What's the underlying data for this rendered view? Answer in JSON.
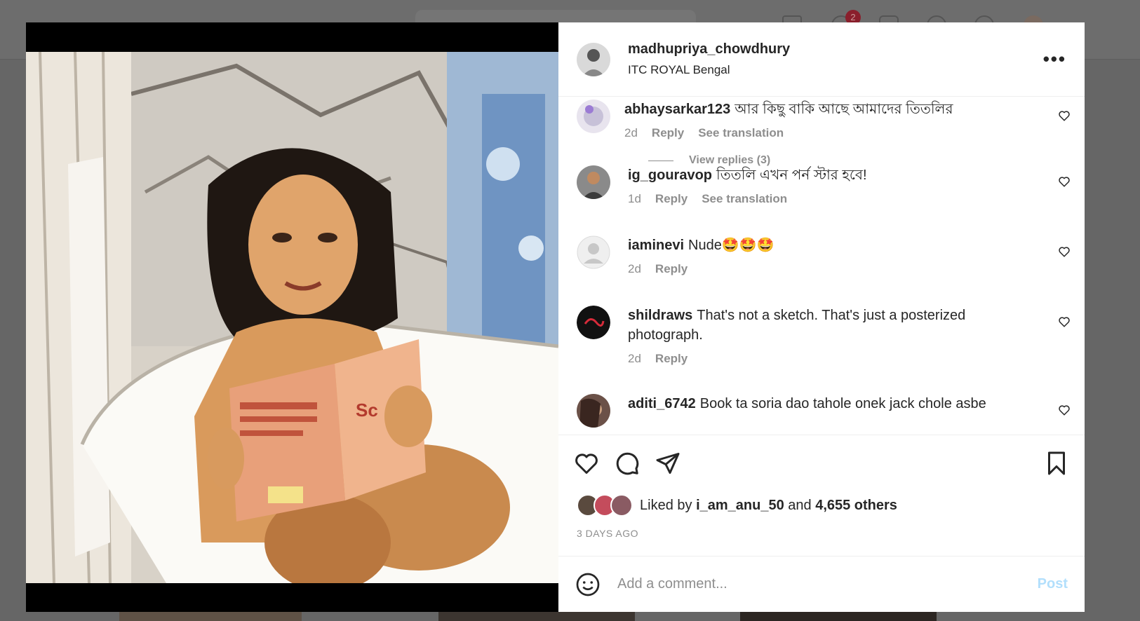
{
  "post": {
    "username": "madhupriya_chowdhury",
    "location": "ITC ROYAL Bengal"
  },
  "comments": [
    {
      "user": "abhaysarkar123",
      "text": "আর কিছু বাকি আছে আমাদের তিতলির",
      "time": "2d",
      "reply": "Reply",
      "translate": "See translation",
      "view_replies": "View replies (3)"
    },
    {
      "user": "ig_gouravop",
      "text": "তিতলি এখন পর্ন স্টার হবে!",
      "time": "1d",
      "reply": "Reply",
      "translate": "See translation"
    },
    {
      "user": "iaminevi",
      "text": "Nude🤩🤩🤩",
      "time": "2d",
      "reply": "Reply"
    },
    {
      "user": "shildraws",
      "text": "That's not a sketch. That's just a posterized photograph.",
      "time": "2d",
      "reply": "Reply"
    },
    {
      "user": "aditi_6742",
      "text": "Book ta soria dao tahole onek jack chole asbe"
    }
  ],
  "likes": {
    "prefix": "Liked by",
    "user": "i_am_anu_50",
    "and": "and",
    "others": "4,655 others"
  },
  "posted_ago": "3 DAYS AGO",
  "add_comment": {
    "placeholder": "Add a comment...",
    "post_label": "Post"
  },
  "background": {
    "notification_count": "2"
  }
}
